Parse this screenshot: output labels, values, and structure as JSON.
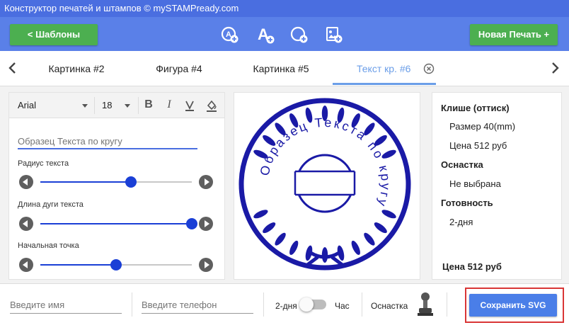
{
  "window": {
    "title": "Конструктор печатей и штампов © mySTAMPready.com"
  },
  "appbar": {
    "back_label": "<  Шаблоны",
    "new_label": "Новая Печать +",
    "tools": [
      "add-circle-text-icon",
      "add-text-icon",
      "add-shape-icon",
      "add-image-icon"
    ]
  },
  "tabs": [
    "Картинка #2",
    "Фигура #4",
    "Картинка #5",
    "Текст кр. #6"
  ],
  "active_tab": 3,
  "editor": {
    "font": "Arial",
    "size": "18",
    "bold": "B",
    "italic": "I",
    "text_placeholder": "Образец Текста по кругу",
    "sliders": [
      {
        "label": "Радиус текста",
        "value": 0.6
      },
      {
        "label": "Длина дуги текста",
        "value": 1.0
      },
      {
        "label": "Начальная точка",
        "value": 0.5
      }
    ]
  },
  "stamp": {
    "circular_text": "Образец Текста по кругу",
    "color": "#1a1aa6"
  },
  "info": {
    "cliche_title": "Клише (оттиск)",
    "size": "Размер 40(mm)",
    "price": "Цена 512 руб",
    "mount_title": "Оснастка",
    "mount_value": "Не выбрана",
    "ready_title": "Готовность",
    "ready_value": "2-дня",
    "total": "Цена 512 руб"
  },
  "bottom": {
    "name_placeholder": "Введите имя",
    "phone_placeholder": "Введите телефон",
    "days_label": "2-дня",
    "hour_label": "Час",
    "mount_label": "Оснастка",
    "save_label": "Сохранить SVG"
  }
}
